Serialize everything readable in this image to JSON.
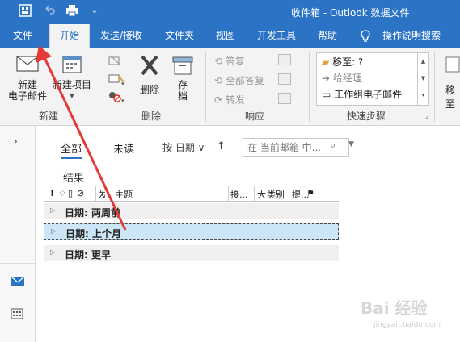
{
  "window": {
    "title": "收件箱 - Outlook 数据文件"
  },
  "quick_access": {
    "send_receive_icon": "send-receive-icon",
    "undo_icon": "undo-icon",
    "print_icon": "print-icon",
    "customize_icon": "customize-icon"
  },
  "tabs": [
    {
      "label": "文件"
    },
    {
      "label": "开始"
    },
    {
      "label": "发送/接收"
    },
    {
      "label": "文件夹"
    },
    {
      "label": "视图"
    },
    {
      "label": "开发工具"
    },
    {
      "label": "帮助"
    },
    {
      "label": "操作说明搜索"
    }
  ],
  "ribbon": {
    "new_group": {
      "label": "新建",
      "new_email": "新建\n电子邮件",
      "new_items": "新建项目"
    },
    "delete_group": {
      "label": "删除",
      "delete": "删除",
      "archive": "存\n档"
    },
    "respond_group": {
      "label": "响应",
      "reply": "答复",
      "reply_all": "全部答复",
      "forward": "转发"
    },
    "quicksteps_group": {
      "label": "快速步骤",
      "items": [
        "移至: ?",
        "给经理",
        "工作组电子邮件"
      ]
    },
    "move_group": {
      "label_partial": "移至"
    }
  },
  "filters": {
    "all": "全部",
    "unread": "未读",
    "sort": "按 日期"
  },
  "search": {
    "placeholder": "在 当前邮箱 中..."
  },
  "results_label": "结果",
  "columns": {
    "subject": "主题",
    "received": "接...",
    "category": "类别",
    "mention": "提..."
  },
  "groups": [
    {
      "label": "日期: 两周前"
    },
    {
      "label": "日期: 上个月"
    },
    {
      "label": "日期: 更早"
    }
  ],
  "watermark": {
    "text": "Bai 经验",
    "sub": "jingyan.baidu.com"
  },
  "colors": {
    "brand": "#2b73c4",
    "selection": "#cde6f7",
    "arrow": "#e53935"
  }
}
